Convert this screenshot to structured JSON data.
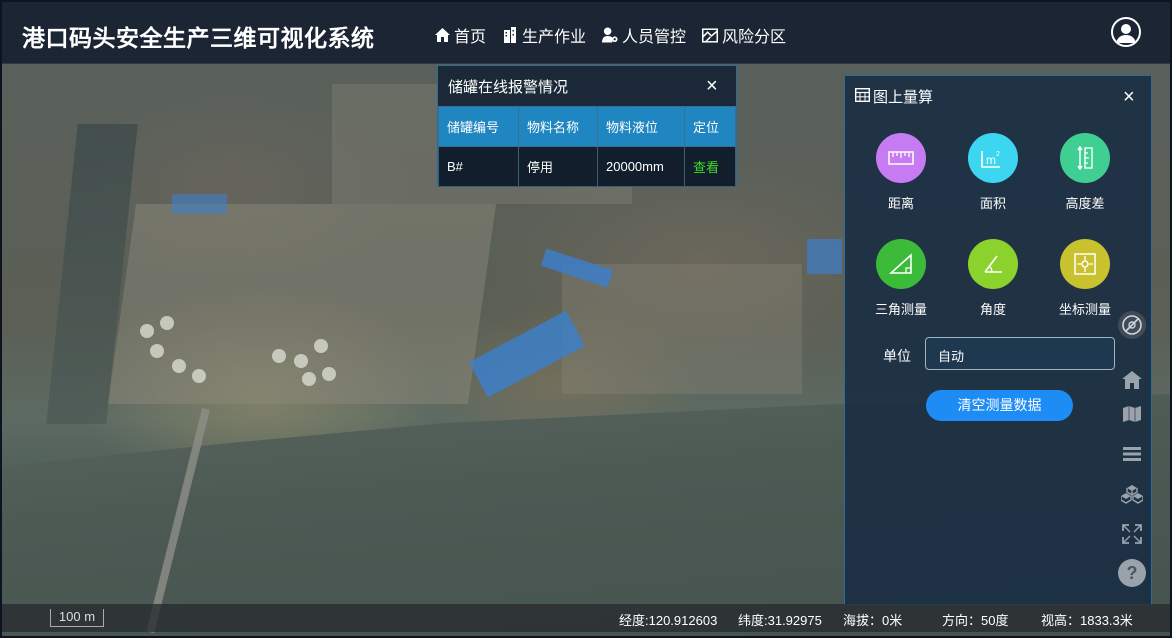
{
  "header": {
    "title": "港口码头安全生产三维可视化系统",
    "nav": [
      {
        "label": "首页",
        "icon": "home-icon"
      },
      {
        "label": "生产作业",
        "icon": "building-icon"
      },
      {
        "label": "人员管控",
        "icon": "user-gear-icon"
      },
      {
        "label": "风险分区",
        "icon": "map-zone-icon"
      }
    ],
    "avatar_icon": "user-avatar-icon"
  },
  "alarm_panel": {
    "title": "储罐在线报警情况",
    "close": "×",
    "columns": [
      "储罐编号",
      "物料名称",
      "物料液位",
      "定位"
    ],
    "rows": [
      {
        "tank_id": "B#",
        "material": "停用",
        "level": "20000mm",
        "locate": "查看"
      }
    ]
  },
  "measure_panel": {
    "title": "图上量算",
    "close": "×",
    "tools": [
      {
        "label": "距离",
        "icon": "ruler-icon",
        "color": "#c67bf2"
      },
      {
        "label": "面积",
        "icon": "area-icon",
        "color": "#3cd6f0"
      },
      {
        "label": "高度差",
        "icon": "height-icon",
        "color": "#3fcf93"
      },
      {
        "label": "三角测量",
        "icon": "triangle-icon",
        "color": "#3cbb3a"
      },
      {
        "label": "角度",
        "icon": "angle-icon",
        "color": "#8bd32c"
      },
      {
        "label": "坐标测量",
        "icon": "coordinate-icon",
        "color": "#c7c22e"
      }
    ],
    "unit_label": "单位",
    "unit_value": "自动",
    "clear_button": "清空测量数据"
  },
  "right_toolbar": [
    "compass-icon",
    "home-view-icon",
    "map-layer-icon",
    "layers-icon",
    "cubes-icon",
    "fullscreen-icon",
    "help-icon"
  ],
  "status_bar": {
    "scale": "100 m",
    "longitude": "经度:120.912603",
    "latitude": "纬度:31.92975",
    "altitude": "海拔：0米",
    "heading": "方向：50度",
    "view_height": "视高：1833.3米"
  }
}
